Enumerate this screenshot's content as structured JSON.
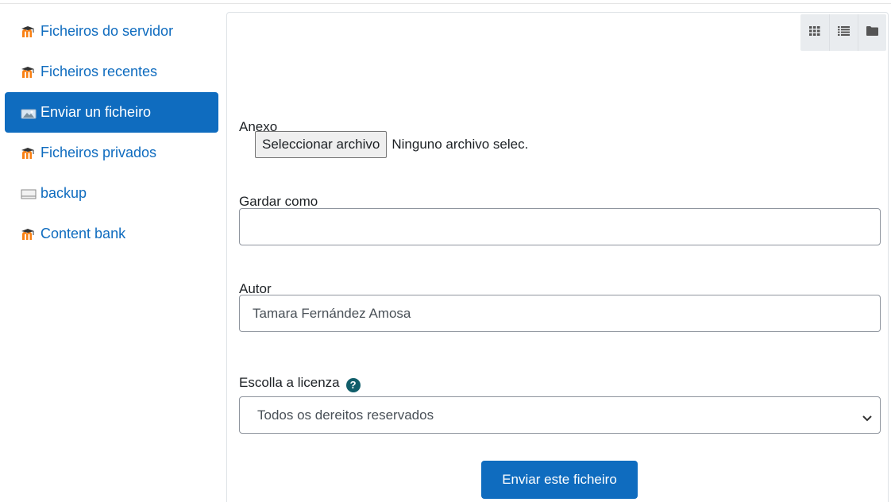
{
  "colors": {
    "link": "#0f6cbf",
    "active_bg": "#0f6cbf",
    "moodle_orange": "#f98012",
    "help_icon": "#115e6a"
  },
  "sidebar": {
    "items": [
      {
        "label": "Ficheiros do servidor",
        "icon": "moodle-icon",
        "active": false
      },
      {
        "label": "Ficheiros recentes",
        "icon": "moodle-icon",
        "active": false
      },
      {
        "label": "Enviar un ficheiro",
        "icon": "upload-icon",
        "active": true
      },
      {
        "label": "Ficheiros privados",
        "icon": "moodle-icon",
        "active": false
      },
      {
        "label": "backup",
        "icon": "drive-icon",
        "active": false
      },
      {
        "label": "Content bank",
        "icon": "moodle-icon",
        "active": false
      }
    ]
  },
  "toolbar": {
    "views": [
      "grid-view-icon",
      "list-view-icon",
      "folder-view-icon"
    ]
  },
  "form": {
    "attachment_label": "Anexo",
    "choose_file_button": "Seleccionar archivo",
    "no_file_text": "Ninguno archivo selec.",
    "save_as_label": "Gardar como",
    "save_as_value": "",
    "author_label": "Autor",
    "author_value": "Tamara Fernández Amosa",
    "license_label": "Escolla a licenza",
    "license_selected": "Todos os dereitos reservados",
    "submit_label": "Enviar este ficheiro"
  }
}
